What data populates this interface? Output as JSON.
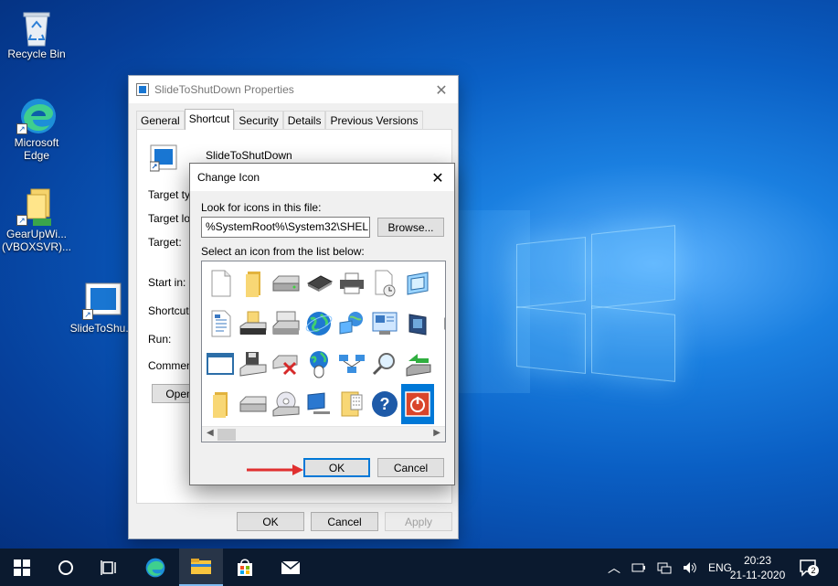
{
  "desktop": {
    "icons": [
      {
        "label": "Recycle Bin",
        "icon": "recycle-bin-icon"
      },
      {
        "label": "Microsoft Edge",
        "icon": "edge-icon"
      },
      {
        "label": "GearUpWi... (VBOXSVR)...",
        "icon": "network-folder-icon"
      },
      {
        "label": "SlideToShu...",
        "icon": "shortcut-app-icon"
      }
    ]
  },
  "properties": {
    "title": "SlideToShutDown Properties",
    "tabs": [
      "General",
      "Shortcut",
      "Security",
      "Details",
      "Previous Versions"
    ],
    "active_tab": "Shortcut",
    "shortcut_name": "SlideToShutDown",
    "fields": {
      "target_type": "Target typ",
      "target_location": "Target loc",
      "target": "Target:",
      "start_in": "Start in:",
      "shortcut_key": "Shortcut k",
      "run": "Run:",
      "comment": "Comment:"
    },
    "open_button": "Open",
    "buttons": {
      "ok": "OK",
      "cancel": "Cancel",
      "apply": "Apply"
    }
  },
  "change_icon": {
    "title": "Change Icon",
    "look_label": "Look for icons in this file:",
    "path_value": "%SystemRoot%\\System32\\SHELL32.dll",
    "browse_button": "Browse...",
    "select_label": "Select an icon from the list below:",
    "icons": [
      "blank-document-icon",
      "folder-icon",
      "drive-icon",
      "chip-icon",
      "printer-icon",
      "document-clock-icon",
      "window-app-icon",
      "partial-icon",
      "text-document-icon",
      "network-drive-icon",
      "disk-tray-icon",
      "globe-icon",
      "network-computer-icon",
      "control-panel-icon",
      "media-icon",
      "shortcut-overlay-icon",
      "application-window-icon",
      "save-disk-icon",
      "drive-removed-icon",
      "globe-mouse-icon",
      "network-links-icon",
      "search-magnifier-icon",
      "network-share-icon",
      "overlay-badge-icon",
      "folder-icon",
      "drive-icon",
      "cd-drive-icon",
      "computer-icon",
      "grid-document-icon",
      "help-icon",
      "power-icon",
      "partial-icon"
    ],
    "selected_index": 30,
    "buttons": {
      "ok": "OK",
      "cancel": "Cancel"
    },
    "arrow_color": "#e03030"
  },
  "taskbar": {
    "tray": {
      "language": "ENG",
      "time": "20:23",
      "date": "21-11-2020",
      "notification_count": "2"
    }
  },
  "colors": {
    "accent": "#0078d7",
    "taskbar": "#0b1a2f",
    "power_icon": "#d9452b"
  }
}
